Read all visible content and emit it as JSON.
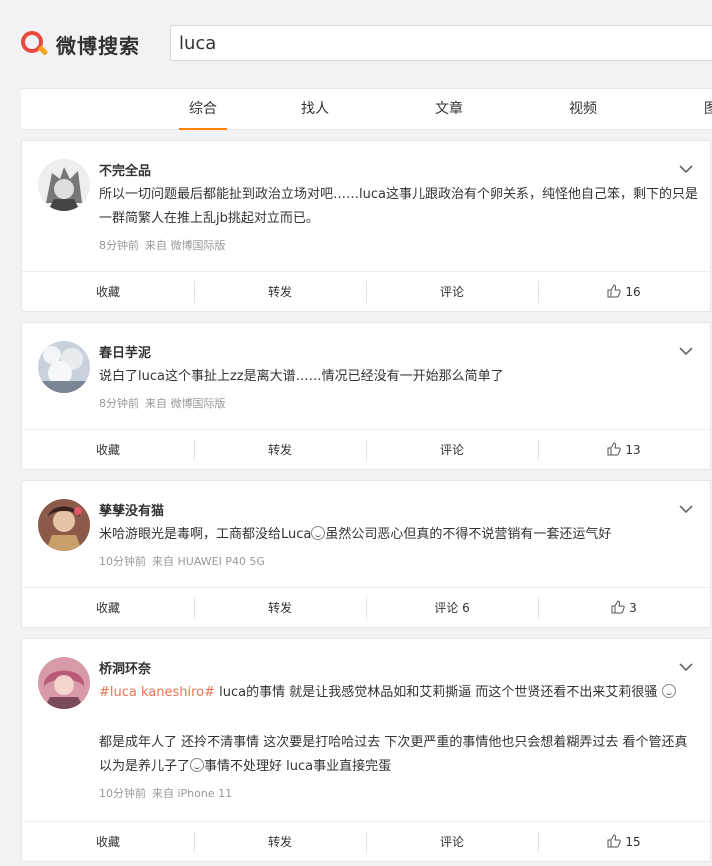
{
  "header": {
    "logo_text": "微博搜索",
    "search_value": "luca"
  },
  "tabs": [
    {
      "label": "综合",
      "active": true
    },
    {
      "label": "找人",
      "active": false
    },
    {
      "label": "文章",
      "active": false
    },
    {
      "label": "视频",
      "active": false
    },
    {
      "label": "图",
      "active": false
    }
  ],
  "posts": [
    {
      "username": "不完全品",
      "text": "所以一切问题最后都能扯到政治立场对吧……luca这事儿跟政治有个卵关系，纯怪他自己笨，剩下的只是一群简繁人在推上乱jb挑起对立而已。",
      "time": "8分钟前",
      "source": "来自 微博国际版",
      "actions": {
        "collect": "收藏",
        "repost": "转发",
        "comment": "评论",
        "likes": "16"
      }
    },
    {
      "username": "春日芋泥",
      "text": "说白了luca这个事扯上zz是离大谱……情况已经没有一开始那么简单了",
      "time": "8分钟前",
      "source": "来自 微博国际版",
      "actions": {
        "collect": "收藏",
        "repost": "转发",
        "comment": "评论",
        "likes": "13"
      }
    },
    {
      "username": "孳孳没有猫",
      "text_a": "米哈游眼光是毒啊，工商都没给Luca",
      "text_b": "虽然公司恶心但真的不得不说营销有一套还运气好",
      "time": "10分钟前",
      "source": "来自 HUAWEI P40 5G",
      "actions": {
        "collect": "收藏",
        "repost": "转发",
        "comment": "评论 6",
        "likes": "3"
      }
    },
    {
      "username": "桥洞环奈",
      "hashtag": "#luca kaneshiro#",
      "text_a": " luca的事情 就是让我感觉林品如和艾莉撕逼 而这个世贤还看不出来艾莉很骚",
      "text_b": "都是成年人了 还拎不清事情 这次要是打哈哈过去 下次更严重的事情他也只会想着糊弄过去 看个管还真以为是养儿子了",
      "text_c": "事情不处理好 luca事业直接完蛋",
      "time": "10分钟前",
      "source": "来自 iPhone 11",
      "actions": {
        "collect": "收藏",
        "repost": "转发",
        "comment": "评论",
        "likes": "15"
      }
    }
  ],
  "colors": {
    "accent": "#ff8200",
    "tag": "#eb7350",
    "meta": "#999999"
  },
  "icons": {
    "chevron": "chevron-down-icon",
    "like": "thumbs-up-icon",
    "search_logo": "search-logo-icon",
    "emoji": "emoji-icon"
  }
}
